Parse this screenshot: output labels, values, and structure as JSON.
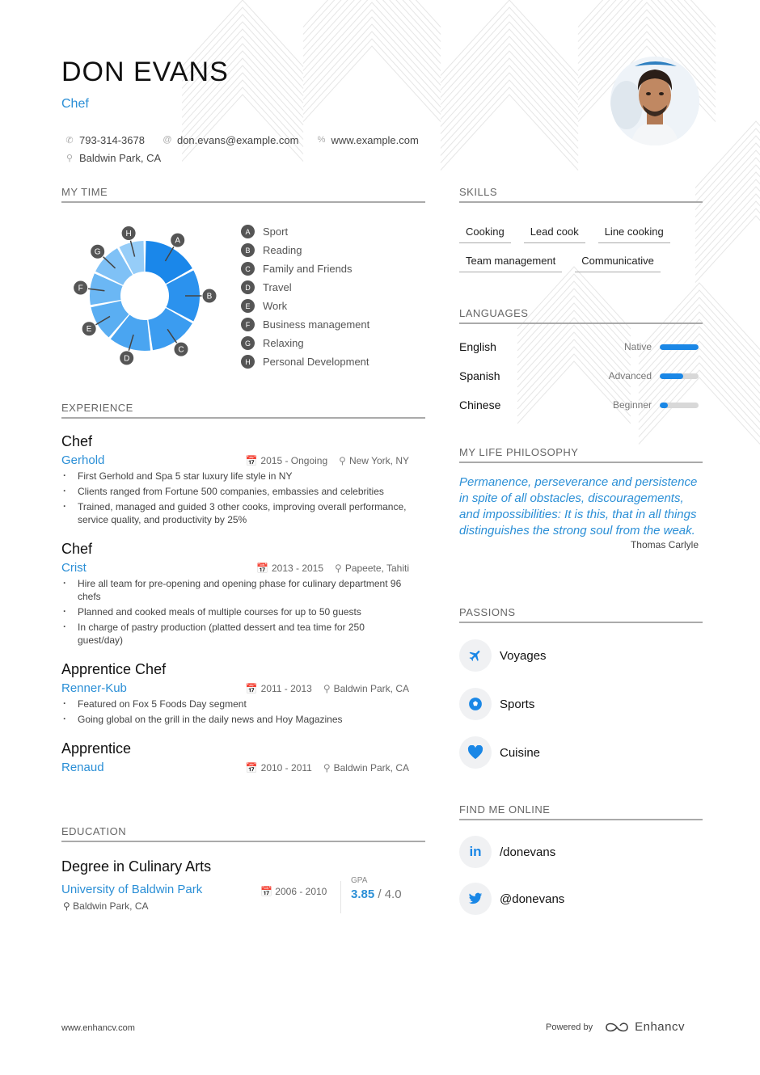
{
  "header": {
    "name": "DON EVANS",
    "role": "Chef",
    "phone": "793-314-3678",
    "email": "don.evans@example.com",
    "website": "www.example.com",
    "location": "Baldwin Park, CA"
  },
  "my_time": {
    "title": "MY TIME",
    "segments": [
      {
        "key": "A",
        "label": "Sport",
        "value": 17,
        "color": "#1a87ea"
      },
      {
        "key": "B",
        "label": "Reading",
        "value": 16,
        "color": "#2b92ee"
      },
      {
        "key": "C",
        "label": "Family and Friends",
        "value": 15,
        "color": "#3b9cf0"
      },
      {
        "key": "D",
        "label": "Travel",
        "value": 13,
        "color": "#4aa5f1"
      },
      {
        "key": "E",
        "label": "Work",
        "value": 11,
        "color": "#5aaef2"
      },
      {
        "key": "F",
        "label": "Business management",
        "value": 10,
        "color": "#6bb7f4"
      },
      {
        "key": "G",
        "label": "Relaxing",
        "value": 10,
        "color": "#7fc1f6"
      },
      {
        "key": "H",
        "label": "Personal Development",
        "value": 8,
        "color": "#96cdf8"
      }
    ]
  },
  "experience": {
    "title": "EXPERIENCE",
    "jobs": [
      {
        "title": "Chef",
        "company": "Gerhold",
        "dates": "2015 - Ongoing",
        "location": "New York, NY",
        "bullets": [
          "First Gerhold and Spa 5 star luxury life style in NY",
          "Clients ranged from Fortune 500 companies, embassies and celebrities",
          "Trained, managed and guided 3 other cooks, improving overall performance, service quality, and productivity by 25%"
        ]
      },
      {
        "title": "Chef",
        "company": "Crist",
        "dates": "2013 - 2015",
        "location": "Papeete, Tahiti",
        "bullets": [
          "Hire all team for pre-opening and opening phase for culinary department 96 chefs",
          "Planned and cooked meals of multiple courses for up to 50 guests",
          "In charge of pastry production (platted dessert and tea time for 250 guest/day)"
        ]
      },
      {
        "title": "Apprentice Chef",
        "company": "Renner-Kub",
        "dates": "2011 - 2013",
        "location": "Baldwin Park, CA",
        "bullets": [
          "Featured on Fox 5 Foods Day segment",
          "Going global on the grill in the daily news and Hoy Magazines"
        ]
      },
      {
        "title": "Apprentice",
        "company": "Renaud",
        "dates": "2010 - 2011",
        "location": "Baldwin Park, CA",
        "bullets": []
      }
    ]
  },
  "education": {
    "title": "EDUCATION",
    "degree": "Degree in Culinary Arts",
    "school": "University of Baldwin Park",
    "dates": "2006 - 2010",
    "location": "Baldwin Park, CA",
    "gpa_label": "GPA",
    "gpa": "3.85",
    "gpa_max": "4.0",
    "gpa_sep": "/"
  },
  "skills": {
    "title": "SKILLS",
    "items": [
      "Cooking",
      "Lead cook",
      "Line cooking",
      "Team management",
      "Communicative"
    ]
  },
  "languages": {
    "title": "LANGUAGES",
    "items": [
      {
        "name": "English",
        "level": "Native",
        "proficiency": 1.0
      },
      {
        "name": "Spanish",
        "level": "Advanced",
        "proficiency": 0.6
      },
      {
        "name": "Chinese",
        "level": "Beginner",
        "proficiency": 0.2
      }
    ]
  },
  "philosophy": {
    "title": "MY LIFE PHILOSOPHY",
    "quote": "Permanence, perseverance and persistence in spite of all obstacles, discouragements, and impossibilities: It is this, that in all things distinguishes the strong soul from the weak.",
    "author": "Thomas Carlyle"
  },
  "passions": {
    "title": "PASSIONS",
    "items": [
      {
        "label": "Voyages",
        "icon": "plane-icon"
      },
      {
        "label": "Sports",
        "icon": "soccer-ball-icon"
      },
      {
        "label": "Cuisine",
        "icon": "heart-icon"
      }
    ]
  },
  "online": {
    "title": "FIND ME ONLINE",
    "items": [
      {
        "label": "/donevans",
        "icon": "linkedin-icon"
      },
      {
        "label": "@donevans",
        "icon": "twitter-icon"
      }
    ]
  },
  "footer": {
    "site": "www.enhancv.com",
    "powered_by": "Powered by",
    "brand": "Enhancv"
  },
  "colors": {
    "accent": "#2b8fd6",
    "bar": "#1a87e6"
  }
}
